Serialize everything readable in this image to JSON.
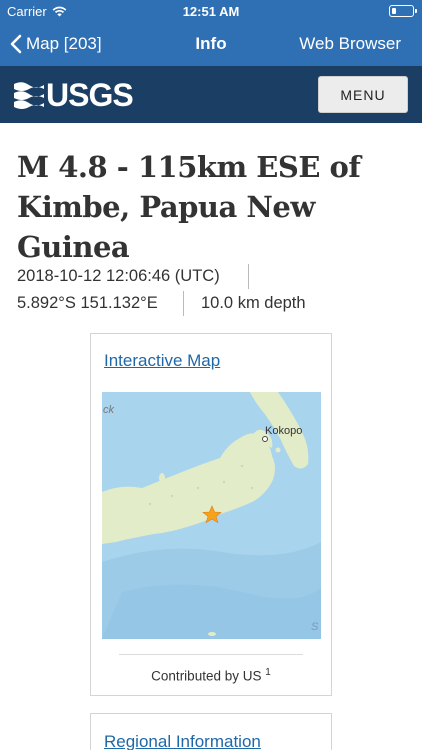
{
  "status_bar": {
    "carrier": "Carrier",
    "time": "12:51 AM",
    "battery_level": 0.25
  },
  "nav": {
    "back_label": "Map [203]",
    "title": "Info",
    "right_label": "Web Browser",
    "back_icon": "chevron-left-icon"
  },
  "header": {
    "logo_text": "USGS",
    "menu_label": "MENU"
  },
  "event": {
    "title": "M 4.8 - 115km ESE of Kimbe, Papua New Guinea",
    "datetime": "2018-10-12 12:06:46 (UTC)",
    "coordinates": "5.892°S 151.132°E",
    "depth": "10.0 km depth"
  },
  "map_card": {
    "link_label": "Interactive Map",
    "place_label": "Kokopo",
    "edge_label_left": "ck",
    "edge_label_right": "S",
    "epicenter_icon": "star-icon",
    "contributed_text": "Contributed by US",
    "contributed_sup": "1"
  },
  "regional_card": {
    "link_label": "Regional Information"
  },
  "colors": {
    "nav_blue": "#2f6fb3",
    "usgs_navy": "#1b3f64",
    "link_blue": "#1f68a8",
    "water": "#a9d4ee",
    "land": "#e3ecc9",
    "epicenter": "#f7a21b"
  }
}
